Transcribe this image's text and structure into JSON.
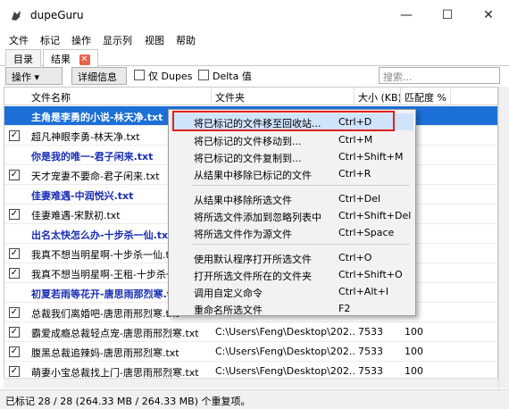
{
  "app": {
    "title": "dupeGuru"
  },
  "window_controls": {
    "minimize": "—",
    "maximize": "☐",
    "close": "✕"
  },
  "menu": [
    "文件",
    "标记",
    "操作",
    "显示列",
    "视图",
    "帮助"
  ],
  "tabs": [
    {
      "label": "目录"
    },
    {
      "label": "结果"
    }
  ],
  "tab_close": "✕",
  "toolbar": {
    "actions_label": "操作 ▾",
    "details_label": "详细信息",
    "dupes_only_label": "仅 Dupes",
    "delta_label": "Delta 值",
    "search_placeholder": "搜索..."
  },
  "columns": [
    "文件名称",
    "文件夹",
    "大小 (KB)",
    "匹配度 %"
  ],
  "rows": [
    {
      "type": "selected",
      "checked": false,
      "name": "主角是李勇的小说-林天净.txt",
      "folder": "",
      "size": "",
      "match": ""
    },
    {
      "type": "dupe",
      "checked": true,
      "name": "超凡神眼李勇-林天净.txt",
      "folder": "",
      "size": "",
      "match": ""
    },
    {
      "type": "group",
      "checked": false,
      "name": "你是我的唯一-君子闲来.txt",
      "folder": "",
      "size": "",
      "match": ""
    },
    {
      "type": "dupe",
      "checked": true,
      "name": "天才宠妻不要命-君子闲来.txt",
      "folder": "",
      "size": "",
      "match": ""
    },
    {
      "type": "group",
      "checked": false,
      "name": "佳妻难遇-中润悦兴.txt",
      "folder": "",
      "size": "",
      "match": ""
    },
    {
      "type": "dupe",
      "checked": true,
      "name": "佳妻难遇-宋默初.txt",
      "folder": "",
      "size": "",
      "match": ""
    },
    {
      "type": "group",
      "checked": false,
      "name": "出名太快怎么办-十步杀一仙.txt",
      "folder": "",
      "size": "",
      "match": ""
    },
    {
      "type": "dupe",
      "checked": true,
      "name": "我真不想当明星啊-十步杀一仙.txt",
      "folder": "",
      "size": "",
      "match": ""
    },
    {
      "type": "dupe",
      "checked": true,
      "name": "我真不想当明星啊-王租-十步杀一仙.txt",
      "folder": "",
      "size": "",
      "match": ""
    },
    {
      "type": "group",
      "checked": false,
      "name": "初夏若雨等花开-唐思雨那烈寒.txt",
      "folder": "",
      "size": "",
      "match": ""
    },
    {
      "type": "dupe",
      "checked": true,
      "name": "总裁我们离婚吧-唐思雨邢烈寒.txt",
      "folder": "",
      "size": "",
      "match": ""
    },
    {
      "type": "dupe",
      "checked": true,
      "name": "霸爱成瘾总裁轻点宠-唐思雨邢烈寒.txt",
      "folder": "C:\\Users\\Feng\\Desktop\\202...",
      "size": "7533",
      "match": "100"
    },
    {
      "type": "dupe",
      "checked": true,
      "name": "腹黑总裁追辣妈-唐思雨邢烈寒.txt",
      "folder": "C:\\Users\\Feng\\Desktop\\202...",
      "size": "7533",
      "match": "100"
    },
    {
      "type": "dupe",
      "checked": true,
      "name": "萌妻小宝总裁找上门-唐思雨邢烈寒.txt",
      "folder": "C:\\Users\\Feng\\Desktop\\202...",
      "size": "7533",
      "match": "100"
    }
  ],
  "context_menu": [
    {
      "label": "将已标记的文件移至回收站...",
      "shortcut": "Ctrl+D"
    },
    {
      "label": "将已标记的文件移动到...",
      "shortcut": "Ctrl+M"
    },
    {
      "label": "将已标记的文件复制到...",
      "shortcut": "Ctrl+Shift+M"
    },
    {
      "label": "从结果中移除已标记的文件",
      "shortcut": "Ctrl+R"
    },
    {
      "label": "从结果中移除所选文件",
      "shortcut": "Ctrl+Del"
    },
    {
      "label": "将所选文件添加到忽略列表中",
      "shortcut": "Ctrl+Shift+Del"
    },
    {
      "label": "将所选文件作为源文件",
      "shortcut": "Ctrl+Space"
    },
    {
      "label": "使用默认程序打开所选文件",
      "shortcut": "Ctrl+O"
    },
    {
      "label": "打开所选文件所在的文件夹",
      "shortcut": "Ctrl+Shift+O"
    },
    {
      "label": "调用自定义命令",
      "shortcut": "Ctrl+Alt+I"
    },
    {
      "label": "重命名所选文件",
      "shortcut": "F2"
    }
  ],
  "status": "已标记 28 / 28 (264.33 MB / 264.33 MB) 个重复项。",
  "colors": {
    "selection": "#1c6fd6",
    "group_text": "#1a2fb5",
    "highlight_box": "#e02020",
    "tab_close": "#e8624a"
  },
  "icons": [
    "app-icon",
    "close-icon",
    "chevron-down-icon",
    "checkmark-icon"
  ]
}
